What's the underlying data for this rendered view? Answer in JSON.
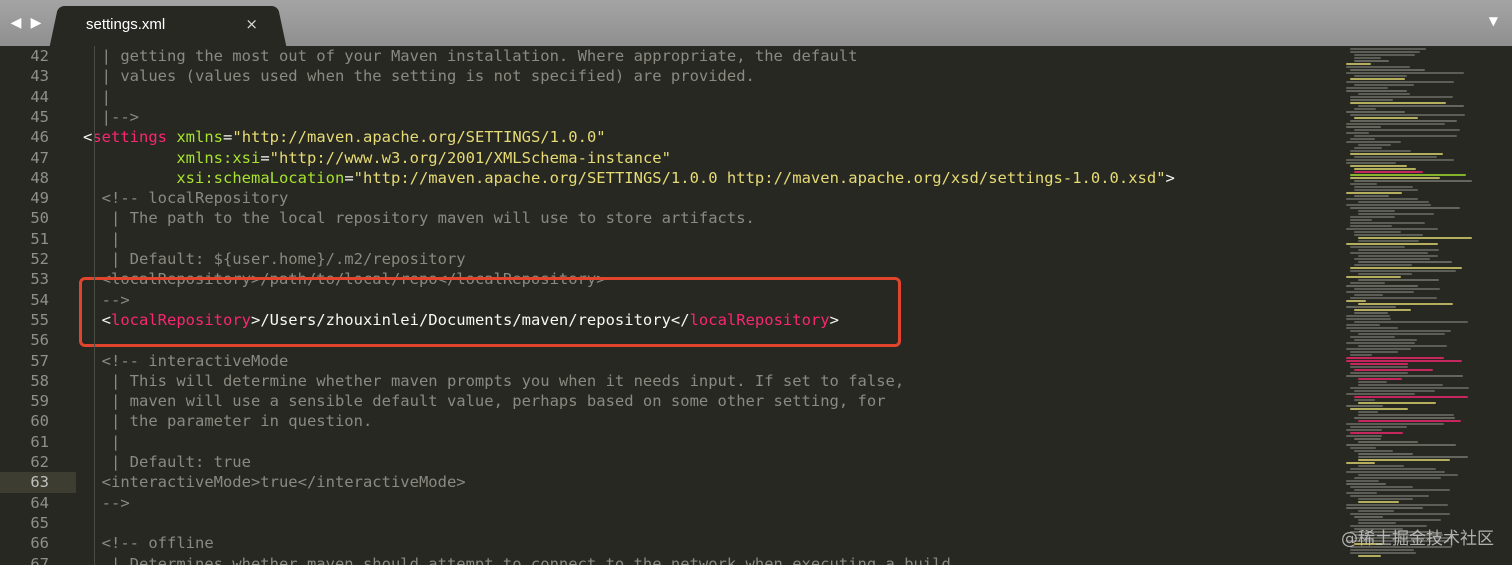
{
  "tab": {
    "title": "settings.xml",
    "close_glyph": "×"
  },
  "nav": {
    "back_glyph": "◀",
    "forward_glyph": "▶",
    "dropdown_glyph": "▼"
  },
  "editor": {
    "current_line": "63",
    "lines": [
      {
        "no": "42",
        "tokens": [
          {
            "k": "c",
            "v": "  | getting the most out of your Maven installation. Where appropriate, the default"
          }
        ]
      },
      {
        "no": "43",
        "tokens": [
          {
            "k": "c",
            "v": "  | values (values used when the setting is not specified) are provided."
          }
        ]
      },
      {
        "no": "44",
        "tokens": [
          {
            "k": "c",
            "v": "  |"
          }
        ]
      },
      {
        "no": "45",
        "tokens": [
          {
            "k": "c",
            "v": "  |-->"
          }
        ]
      },
      {
        "no": "46",
        "tokens": [
          {
            "k": "p",
            "v": "<"
          },
          {
            "k": "t",
            "v": "settings"
          },
          {
            "k": "p",
            "v": " "
          },
          {
            "k": "a",
            "v": "xmlns"
          },
          {
            "k": "p",
            "v": "="
          },
          {
            "k": "s",
            "v": "\"http://maven.apache.org/SETTINGS/1.0.0\""
          }
        ]
      },
      {
        "no": "47",
        "tokens": [
          {
            "k": "p",
            "v": "          "
          },
          {
            "k": "a",
            "v": "xmlns:xsi"
          },
          {
            "k": "p",
            "v": "="
          },
          {
            "k": "s",
            "v": "\"http://www.w3.org/2001/XMLSchema-instance\""
          }
        ]
      },
      {
        "no": "48",
        "tokens": [
          {
            "k": "p",
            "v": "          "
          },
          {
            "k": "a",
            "v": "xsi:schemaLocation"
          },
          {
            "k": "p",
            "v": "="
          },
          {
            "k": "s",
            "v": "\"http://maven.apache.org/SETTINGS/1.0.0 http://maven.apache.org/xsd/settings-1.0.0.xsd\""
          },
          {
            "k": "p",
            "v": ">"
          }
        ]
      },
      {
        "no": "49",
        "tokens": [
          {
            "k": "c",
            "v": "  <!-- localRepository"
          }
        ]
      },
      {
        "no": "50",
        "tokens": [
          {
            "k": "c",
            "v": "   | The path to the local repository maven will use to store artifacts."
          }
        ]
      },
      {
        "no": "51",
        "tokens": [
          {
            "k": "c",
            "v": "   |"
          }
        ]
      },
      {
        "no": "52",
        "tokens": [
          {
            "k": "c",
            "v": "   | Default: ${user.home}/.m2/repository"
          }
        ]
      },
      {
        "no": "53",
        "tokens": [
          {
            "k": "c",
            "v": "  <localRepository>/path/to/local/repo</localRepository>"
          }
        ]
      },
      {
        "no": "54",
        "tokens": [
          {
            "k": "c",
            "v": "  -->"
          }
        ]
      },
      {
        "no": "55",
        "tokens": [
          {
            "k": "p",
            "v": "  <"
          },
          {
            "k": "t",
            "v": "localRepository"
          },
          {
            "k": "p",
            "v": ">/Users/zhouxinlei/Documents/maven/repository</"
          },
          {
            "k": "t",
            "v": "localRepository"
          },
          {
            "k": "p",
            "v": ">"
          }
        ]
      },
      {
        "no": "56",
        "tokens": [
          {
            "k": "p",
            "v": ""
          }
        ]
      },
      {
        "no": "57",
        "tokens": [
          {
            "k": "c",
            "v": "  <!-- interactiveMode"
          }
        ]
      },
      {
        "no": "58",
        "tokens": [
          {
            "k": "c",
            "v": "   | This will determine whether maven prompts you when it needs input. If set to false,"
          }
        ]
      },
      {
        "no": "59",
        "tokens": [
          {
            "k": "c",
            "v": "   | maven will use a sensible default value, perhaps based on some other setting, for"
          }
        ]
      },
      {
        "no": "60",
        "tokens": [
          {
            "k": "c",
            "v": "   | the parameter in question."
          }
        ]
      },
      {
        "no": "61",
        "tokens": [
          {
            "k": "c",
            "v": "   |"
          }
        ]
      },
      {
        "no": "62",
        "tokens": [
          {
            "k": "c",
            "v": "   | Default: true"
          }
        ]
      },
      {
        "no": "63",
        "tokens": [
          {
            "k": "c",
            "v": "  <interactiveMode>true</interactiveMode>"
          }
        ]
      },
      {
        "no": "64",
        "tokens": [
          {
            "k": "c",
            "v": "  -->"
          }
        ]
      },
      {
        "no": "65",
        "tokens": [
          {
            "k": "p",
            "v": ""
          }
        ]
      },
      {
        "no": "66",
        "tokens": [
          {
            "k": "c",
            "v": "  <!-- offline"
          }
        ]
      },
      {
        "no": "67",
        "tokens": [
          {
            "k": "c",
            "v": "   | Determines whether maven should attempt to connect to the network when executing a build."
          }
        ]
      }
    ]
  },
  "annotation": {
    "color": "#e2452d"
  },
  "watermark": "@稀土掘金技术社区",
  "colors": {
    "background": "#272822",
    "comment": "#8a8a82",
    "tag": "#f92672",
    "attribute": "#a6e22e",
    "string": "#e6db74",
    "punctuation": "#f8f8f2"
  }
}
